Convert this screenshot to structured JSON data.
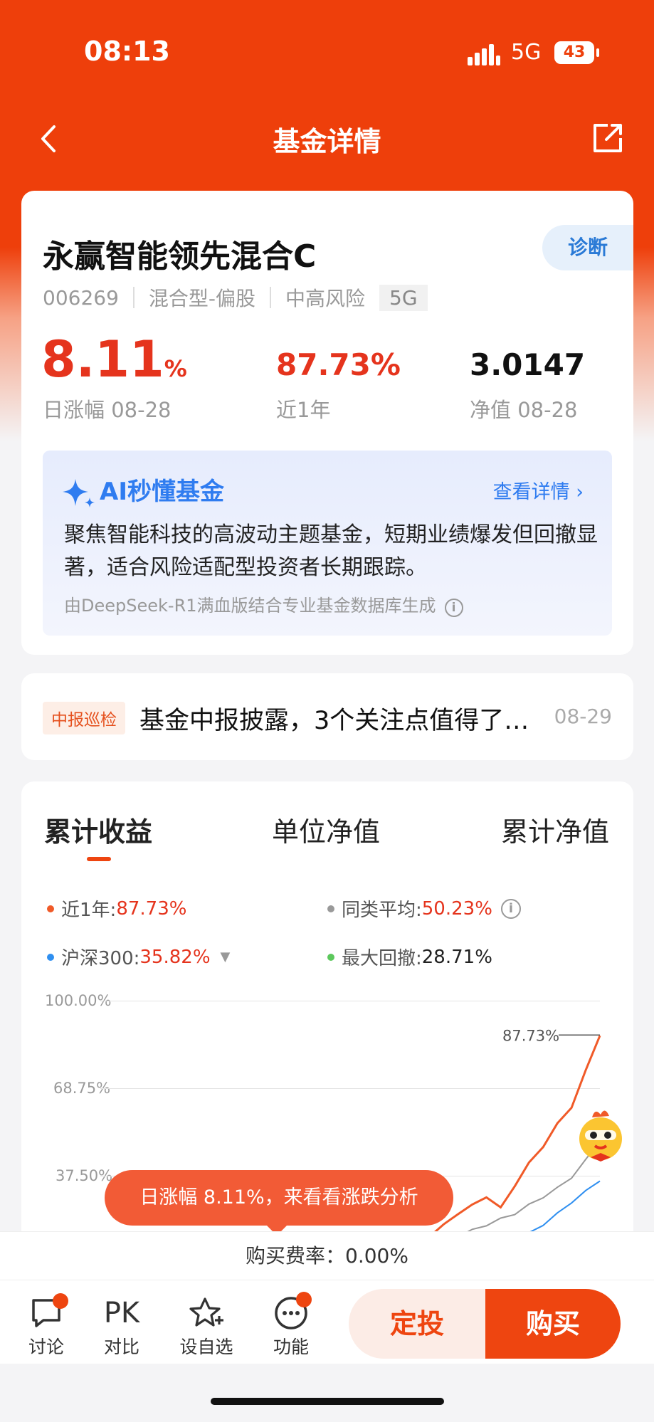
{
  "status": {
    "time": "08:13",
    "network": "5G",
    "battery": "43"
  },
  "nav": {
    "title": "基金详情"
  },
  "fund": {
    "name": "永赢智能领先混合C",
    "code": "006269",
    "type": "混合型-偏股",
    "risk": "中高风险",
    "tag": "5G",
    "diagnose": "诊断",
    "daily_value": "8.11",
    "daily_unit": "%",
    "daily_label": "日涨幅 08-28",
    "year_value": "87.73%",
    "year_label": "近1年",
    "nav_value": "3.0147",
    "nav_label": "净值 08-28"
  },
  "ai": {
    "title": "AI秒懂基金",
    "more": "查看详情",
    "text": "聚焦智能科技的高波动主题基金，短期业绩爆发但回撤显著，适合风险适配型投资者长期跟踪。",
    "source": "由DeepSeek-R1满血版结合专业基金数据库生成"
  },
  "news": {
    "tag": "中报巡检",
    "text": "基金中报披露，3个关注点值得了…",
    "date": "08-29"
  },
  "tabs": [
    "累计收益",
    "单位净值",
    "累计净值"
  ],
  "legend": {
    "fund_label": "近1年:",
    "fund_value": "87.73%",
    "avg_label": "同类平均:",
    "avg_value": "50.23%",
    "hs_label": "沪深300:",
    "hs_value": "35.82%",
    "dd_label": "最大回撤:",
    "dd_value": "28.71%"
  },
  "colors": {
    "accent": "#ee3f0b",
    "fund": "#f05a28",
    "avg": "#999999",
    "hs300": "#2f8ff0",
    "drawdown": "#5cc85c"
  },
  "chart_data": {
    "type": "line",
    "yticks": [
      "100.00%",
      "68.75%",
      "37.50%"
    ],
    "ylim": [
      0,
      100
    ],
    "end_label": "87.73%",
    "series": [
      {
        "name": "近1年",
        "end_value": 87.73,
        "values": [
          0,
          0.5,
          0.3,
          0.8,
          1.0,
          1.5,
          1.2,
          2.0,
          3.0,
          2.6,
          3.5,
          4.5,
          5.0,
          5.2,
          6.0,
          6.5,
          8.0,
          10.0,
          13.0,
          16.0,
          20.0,
          24.0,
          27.0,
          30.0,
          26.0,
          34.0,
          42.0,
          48.0,
          56.0,
          62.0,
          75.0,
          87.73
        ]
      },
      {
        "name": "同类平均",
        "end_value": 50.23,
        "values": [
          0,
          0.5,
          0.8,
          1.0,
          1.5,
          1.8,
          1.6,
          2.5,
          3.0,
          3.5,
          4.0,
          4.5,
          5.0,
          5.5,
          6.0,
          7.0,
          8.5,
          10.0,
          11.5,
          12.5,
          14.0,
          16.0,
          18.0,
          20.0,
          22.0,
          24.0,
          27.0,
          30.0,
          33.0,
          37.0,
          43.0,
          50.23
        ]
      },
      {
        "name": "沪深300",
        "end_value": 35.82,
        "values": [
          0,
          0.1,
          0.2,
          0.3,
          0.1,
          0.4,
          0.5,
          0.8,
          0.6,
          0.9,
          1.1,
          1.4,
          1.6,
          1.8,
          2.2,
          2.6,
          3.0,
          3.6,
          4.2,
          5.0,
          6.0,
          7.2,
          8.6,
          10.0,
          12.0,
          14.0,
          17.0,
          20.0,
          24.0,
          28.0,
          32.0,
          35.82
        ]
      }
    ]
  },
  "bubble": "日涨幅 8.11%，来看看涨跌分析",
  "fee": "购买费率：0.00%",
  "bottom": {
    "discuss": "讨论",
    "pk": "PK",
    "compare": "对比",
    "watch": "设自选",
    "func": "功能",
    "sip": "定投",
    "buy": "购买"
  }
}
